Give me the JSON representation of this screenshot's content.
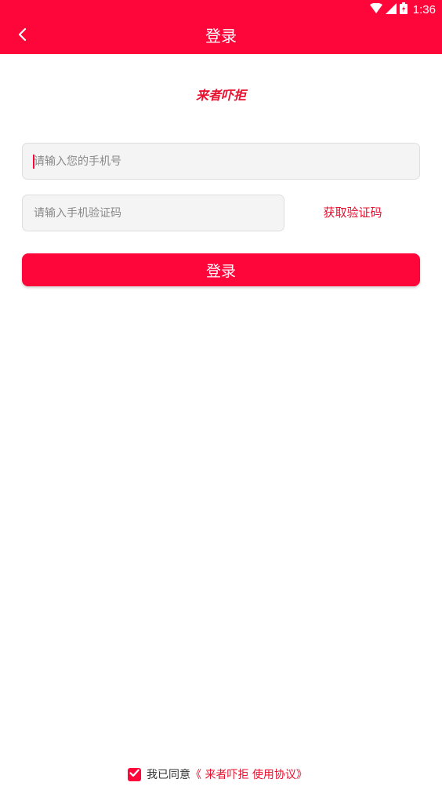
{
  "status_bar": {
    "time": "1:36",
    "icons": [
      "wifi-icon",
      "signal-icon",
      "battery-icon"
    ]
  },
  "header": {
    "title": "登录",
    "back_icon": "back-chevron-icon"
  },
  "logo": {
    "text": "来者吓拒"
  },
  "form": {
    "phone_placeholder": "请输入您的手机号",
    "phone_value": "",
    "code_placeholder": "请输入手机验证码",
    "code_value": "",
    "get_code_label": "获取验证码",
    "login_label": "登录"
  },
  "agreement": {
    "checked": true,
    "prefix": "我已同意",
    "link_text": "《 来者吓拒 使用协议》"
  },
  "colors": {
    "brand": "#ff063b",
    "link": "#e8102f",
    "input_bg": "#f4f4f4",
    "input_border": "#dedede"
  }
}
